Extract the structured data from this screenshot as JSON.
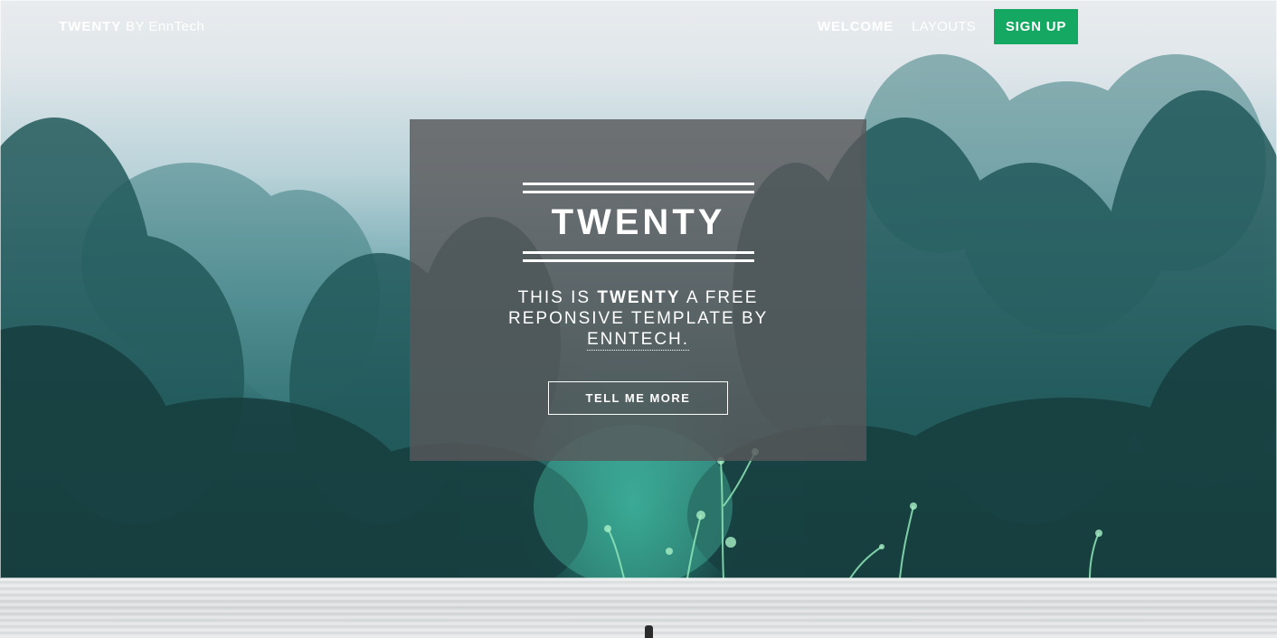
{
  "header": {
    "brand_bold": "TWENTY",
    "brand_rest": "BY EnnTech",
    "nav": {
      "welcome": "WELCOME",
      "layouts": "LAYOUTS",
      "signup": "SIGN UP"
    }
  },
  "hero": {
    "title": "TWENTY",
    "tagline_prefix": "THIS IS",
    "tagline_bold": "TWENTY",
    "tagline_middle": "A FREE REPONSIVE TEMPLATE BY",
    "tagline_link": "ENNTECH.",
    "cta_label": "TELL ME MORE"
  },
  "colors": {
    "accent": "#14a862",
    "panel": "#58585a",
    "text": "#ffffff"
  }
}
